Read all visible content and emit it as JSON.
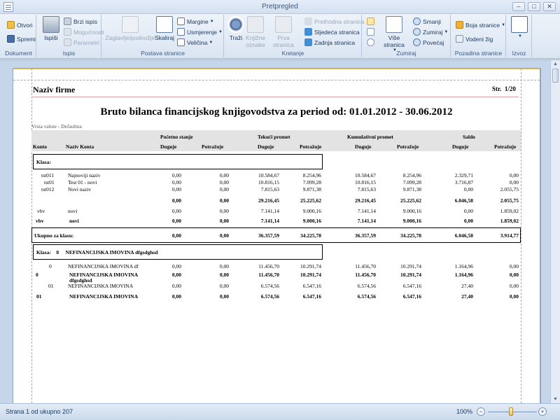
{
  "window": {
    "title": "Pretpregled",
    "minimize": "–",
    "maximize": "□",
    "close": "✕"
  },
  "ribbon": {
    "dokument": {
      "label": "Dokument",
      "otvori": "Otvori",
      "spremi": "Spremi"
    },
    "ispis": {
      "label": "Ispis",
      "ispisi": "Ispiši",
      "brzi_ispis": "Brzi ispis",
      "mogucnosti": "Mogućnosti",
      "parametri": "Parametri"
    },
    "postava": {
      "label": "Postava stranice",
      "zaglavlje": "Zaglavlje/podnožje",
      "skaliraj": "Skaliraj",
      "margine": "Margine",
      "usmjerenje": "Usmjerenje",
      "velicina": "Veličina"
    },
    "kretanje": {
      "label": "Kretanje",
      "trazi": "Traži",
      "knjizne_oznake": "Knjižne oznake",
      "prva_stranica": "Prva stranica",
      "prethodna": "Prethodna stranica",
      "sljedeca": "Sljedeća stranica",
      "zadnja": "Zadnja stranica"
    },
    "zumiraj": {
      "label": "Zumiraj",
      "vise_stranica": "Više stranica",
      "smanji": "Smanji",
      "zumiraj": "Zumiraj",
      "povecaj": "Povećaj"
    },
    "pozadina": {
      "label": "Pozadina stranice",
      "boja": "Boja stranice",
      "vodeni_zig": "Vodeni žig"
    },
    "izvoz": {
      "label": "Izvoz"
    }
  },
  "report": {
    "firm": "Naziv firme",
    "page_label": "Str.",
    "page_value": "1/20",
    "title": "Bruto bilanca financijskog knjigovodstva za period od: 01.01.2012 - 30.06.2012",
    "currency_type": "Vrsta valute - Defaultna",
    "group_headers": [
      "Početno stanje",
      "Tekući promet",
      "Kumulativni promet",
      "Saldo"
    ],
    "col_konto": "Konto",
    "col_naziv": "Naziv Konta",
    "col_duguje": "Duguje",
    "col_potrazuje": "Potražuje",
    "section1": {
      "label": "Klasa:",
      "rows": [
        {
          "konto": "tst011",
          "naziv": "Najnoviji naziv",
          "vals": [
            "0,00",
            "0,00",
            "10.584,67",
            "8.254,96",
            "10.584,67",
            "8.254,96",
            "2.329,71",
            "0,00"
          ]
        },
        {
          "konto": "tst01",
          "naziv": "Test 01 - novi",
          "vals": [
            "0,00",
            "0,00",
            "10.816,15",
            "7.099,28",
            "10.816,15",
            "7.099,28",
            "3.716,87",
            "0,00"
          ]
        },
        {
          "konto": "tst012",
          "naziv": "Novi naziv",
          "vals": [
            "0,00",
            "0,00",
            "7.815,63",
            "9.871,38",
            "7.815,63",
            "9.871,38",
            "0,00",
            "2.055,75"
          ]
        }
      ],
      "subtotal": [
        "0,00",
        "0,00",
        "29.216,45",
        "25.225,62",
        "29.216,45",
        "25.225,62",
        "6.046,58",
        "2.055,75"
      ],
      "vbv_row": {
        "konto": "vbv",
        "naziv": "novi",
        "vals": [
          "0,00",
          "0,00",
          "7.141,14",
          "9.000,16",
          "7.141,14",
          "9.000,16",
          "0,00",
          "1.859,02"
        ]
      },
      "vbv_total": {
        "konto": "vbv",
        "naziv": "novi",
        "vals": [
          "0,00",
          "0,00",
          "7.141,14",
          "9.000,16",
          "7.141,14",
          "9.000,16",
          "0,00",
          "1.859,02"
        ]
      },
      "total_label": "Ukupno za klasu:",
      "total": [
        "0,00",
        "0,00",
        "36.357,59",
        "34.225,78",
        "36.357,59",
        "34.225,78",
        "6.046,58",
        "3.914,77"
      ]
    },
    "section2": {
      "label": "Klasa:",
      "klasa_no": "0",
      "klasa_name": "NEFINANCIJSKA IMOVINA dfgsdghsd",
      "row1": {
        "konto": "0",
        "naziv": "NEFINANCIJSKA IMOVINA df",
        "vals": [
          "0,00",
          "0,00",
          "11.456,70",
          "10.291,74",
          "11.456,70",
          "10.291,74",
          "1.164,96",
          "0,00"
        ]
      },
      "row1_total": {
        "konto": "0",
        "naziv_a": "NEFINANCIJSKA IMOVINA",
        "naziv_b": "dfgsdghsd",
        "vals": [
          "0,00",
          "0,00",
          "11.456,70",
          "10.291,74",
          "11.456,70",
          "10.291,74",
          "1.164,96",
          "0,00"
        ]
      },
      "row2": {
        "konto": "01",
        "naziv": "NEFINANCIJSKA IMOVINA",
        "vals": [
          "0,00",
          "0,00",
          "6.574,56",
          "6.547,16",
          "6.574,56",
          "6.547,16",
          "27,40",
          "0,00"
        ]
      },
      "row2_total": {
        "konto": "01",
        "naziv": "NEFINANCIJSKA IMOVINA",
        "vals": [
          "0,00",
          "0,00",
          "6.574,56",
          "6.547,16",
          "6.574,56",
          "6.547,16",
          "27,40",
          "0,00"
        ]
      }
    }
  },
  "status": {
    "text": "Strana 1 od ukupno 207",
    "zoom": "100%",
    "zoom_out": "−",
    "zoom_in": "+"
  }
}
